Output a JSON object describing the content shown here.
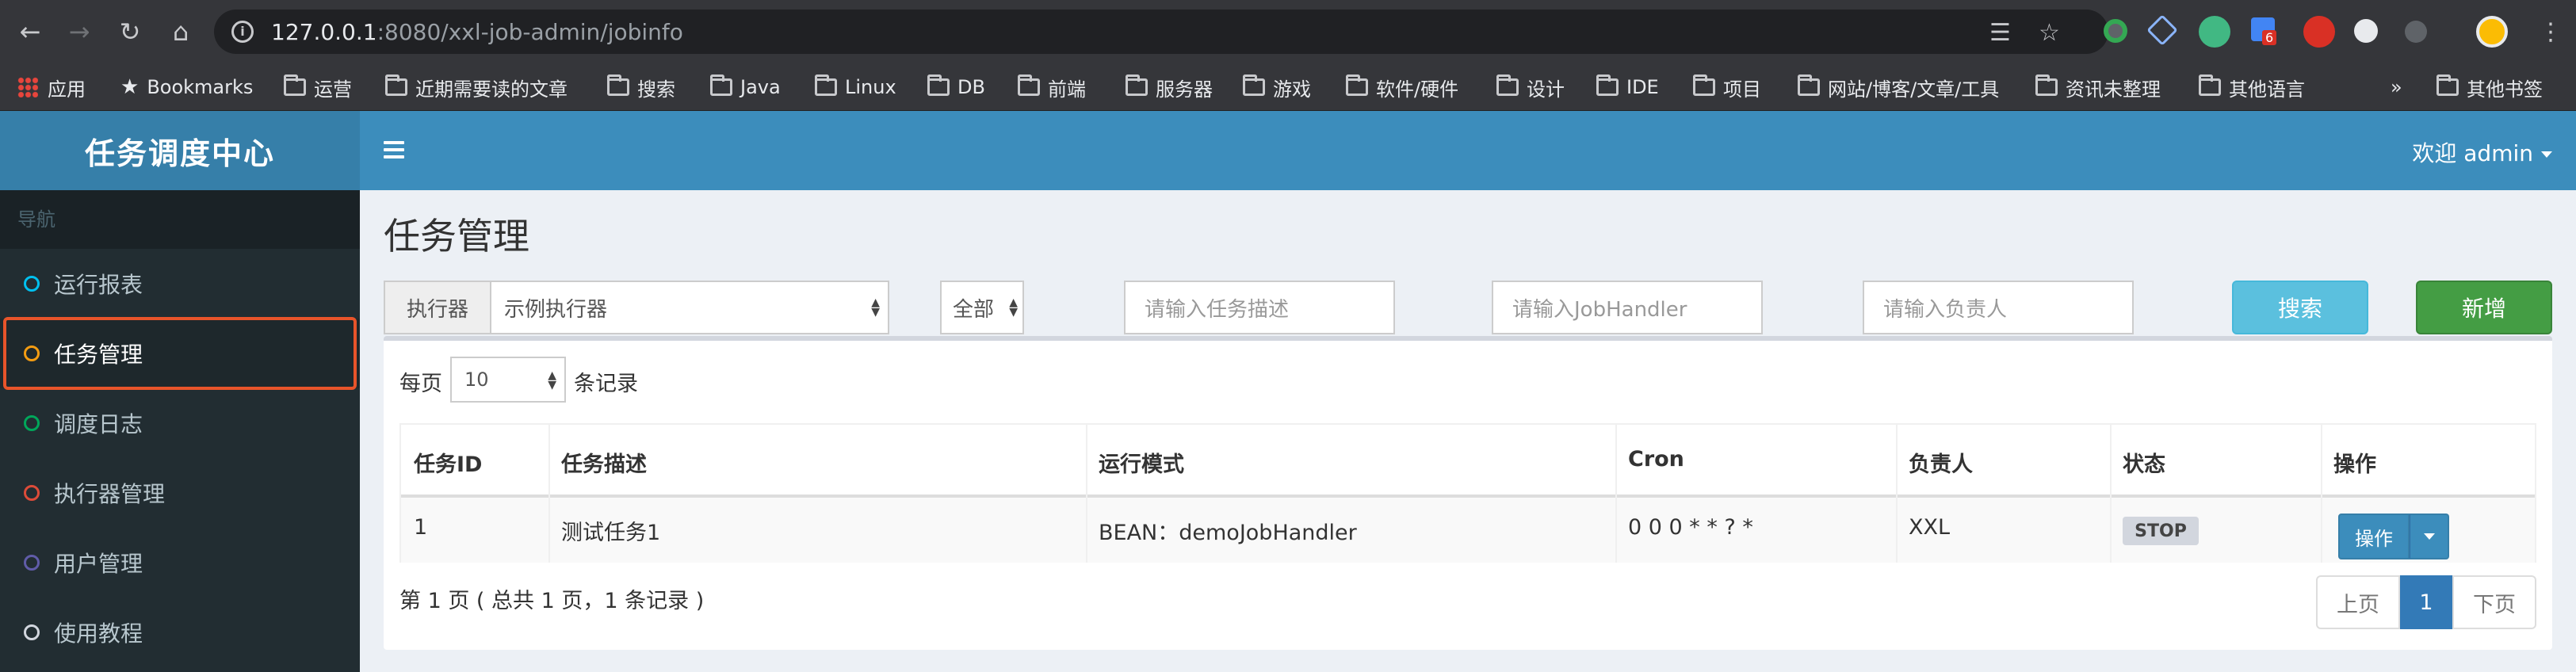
{
  "browser": {
    "url_host": "127.0.0.1",
    "url_rest": ":8080/xxl-job-admin/jobinfo",
    "bookmarks": [
      "应用",
      "Bookmarks",
      "运营",
      "近期需要读的文章",
      "搜索",
      "Java",
      "Linux",
      "DB",
      "前端",
      "服务器",
      "游戏",
      "软件/硬件",
      "设计",
      "IDE",
      "项目",
      "网站/博客/文章/工具",
      "资讯未整理",
      "其他语言",
      "»",
      "其他书签"
    ],
    "extension_badge": "6"
  },
  "header": {
    "logo": "任务调度中心",
    "user": "欢迎 admin"
  },
  "sidebar": {
    "section": "导航",
    "items": [
      {
        "label": "运行报表",
        "color": "#00c0ef"
      },
      {
        "label": "任务管理",
        "color": "#f39c12"
      },
      {
        "label": "调度日志",
        "color": "#00a65a"
      },
      {
        "label": "执行器管理",
        "color": "#dd4b39"
      },
      {
        "label": "用户管理",
        "color": "#605ca8"
      },
      {
        "label": "使用教程",
        "color": "#d2d6de"
      }
    ]
  },
  "main": {
    "title": "任务管理",
    "filters": {
      "executor_label": "执行器",
      "executor_value": "示例执行器",
      "status_value": "全部",
      "desc_placeholder": "请输入任务描述",
      "handler_placeholder": "请输入JobHandler",
      "author_placeholder": "请输入负责人",
      "search_label": "搜索",
      "add_label": "新增"
    },
    "per_page": {
      "prefix": "每页",
      "value": "10",
      "suffix": "条记录"
    },
    "table": {
      "headers": [
        "任务ID",
        "任务描述",
        "运行模式",
        "Cron",
        "负责人",
        "状态",
        "操作"
      ],
      "rows": [
        {
          "id": "1",
          "desc": "测试任务1",
          "mode": "BEAN：demoJobHandler",
          "cron": "0 0 0 * * ? *",
          "author": "XXL",
          "status": "STOP",
          "op": "操作"
        }
      ]
    },
    "pagination": {
      "info": "第 1 页 ( 总共 1 页，1 条记录 )",
      "prev": "上页",
      "current": "1",
      "next": "下页"
    }
  }
}
